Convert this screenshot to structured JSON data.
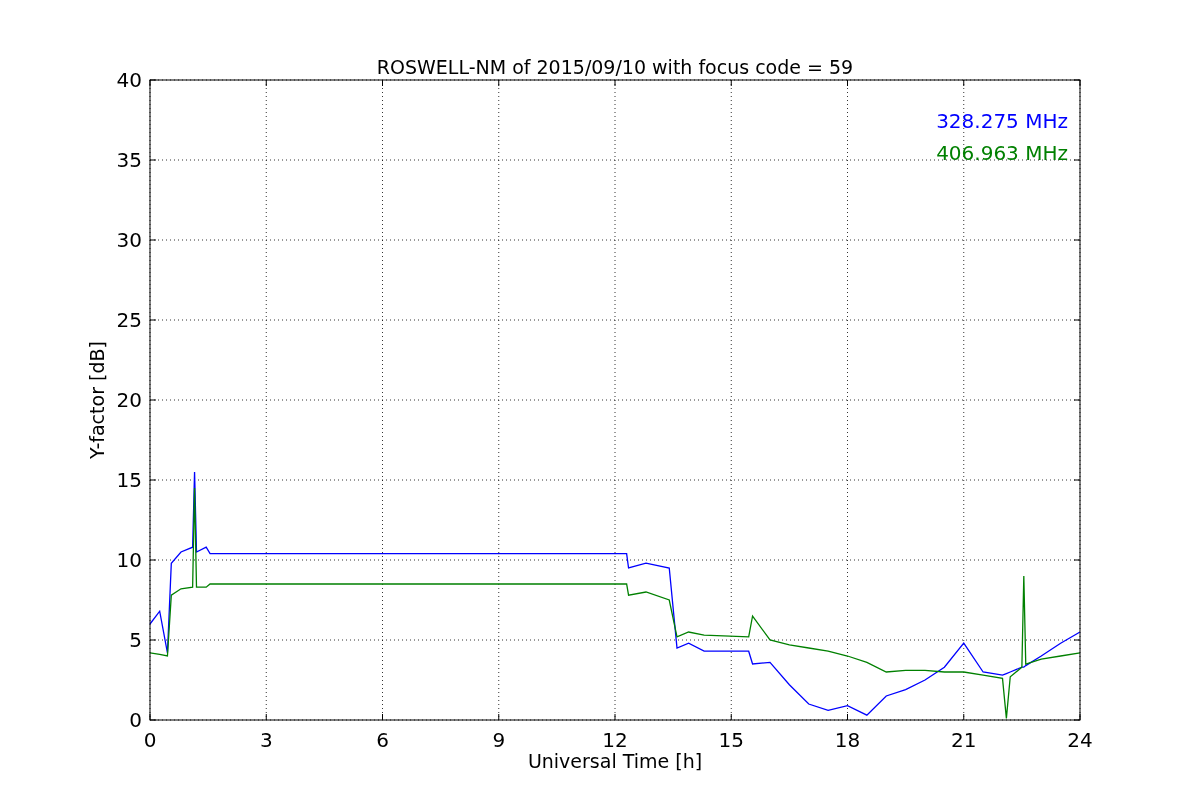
{
  "chart_data": {
    "type": "line",
    "title": "ROSWELL-NM of 2015/09/10 with focus code = 59",
    "xlabel": "Universal Time [h]",
    "ylabel": "Y-factor [dB]",
    "x": [
      0,
      0.25,
      0.45,
      0.55,
      0.8,
      1.1,
      1.15,
      1.2,
      1.45,
      1.55,
      12.3,
      12.35,
      12.8,
      13.4,
      13.6,
      13.9,
      14.3,
      15.45,
      15.55,
      16,
      16.5,
      17,
      17.5,
      18,
      18.5,
      19,
      19.5,
      20,
      20.5,
      21,
      21.5,
      22,
      22.1,
      22.2,
      22.5,
      22.55,
      22.6,
      23,
      23.5,
      24
    ],
    "series": [
      {
        "name": "328.275 MHz",
        "color": "#0000ff",
        "values": [
          6,
          6.8,
          4.2,
          9.8,
          10.5,
          10.8,
          15.5,
          10.5,
          10.8,
          10.4,
          10.4,
          9.5,
          9.8,
          9.5,
          4.5,
          4.8,
          4.3,
          4.3,
          3.5,
          3.6,
          2.2,
          1,
          0.6,
          0.9,
          0.3,
          1.5,
          1.9,
          2.5,
          3.3,
          4.8,
          3,
          2.8,
          2.9,
          3,
          3.3,
          3.3,
          3.4,
          4,
          4.8,
          5.5
        ]
      },
      {
        "name": "406.963 MHz",
        "color": "#008000",
        "values": [
          4.2,
          4.1,
          4,
          7.8,
          8.2,
          8.3,
          14.5,
          8.3,
          8.3,
          8.5,
          8.5,
          7.8,
          8,
          7.5,
          5.2,
          5.5,
          5.3,
          5.2,
          6.5,
          5,
          4.7,
          4.5,
          4.3,
          4,
          3.6,
          3,
          3.1,
          3.1,
          3,
          3,
          2.8,
          2.6,
          0.1,
          2.7,
          3.3,
          9,
          3.5,
          3.8,
          4,
          4.2
        ]
      }
    ],
    "grid": true,
    "xlim": [
      0,
      24
    ],
    "ylim": [
      0,
      40
    ],
    "xticks": [
      0,
      3,
      6,
      9,
      12,
      15,
      18,
      21,
      24
    ],
    "yticks": [
      0,
      5,
      10,
      15,
      20,
      25,
      30,
      35,
      40
    ]
  }
}
